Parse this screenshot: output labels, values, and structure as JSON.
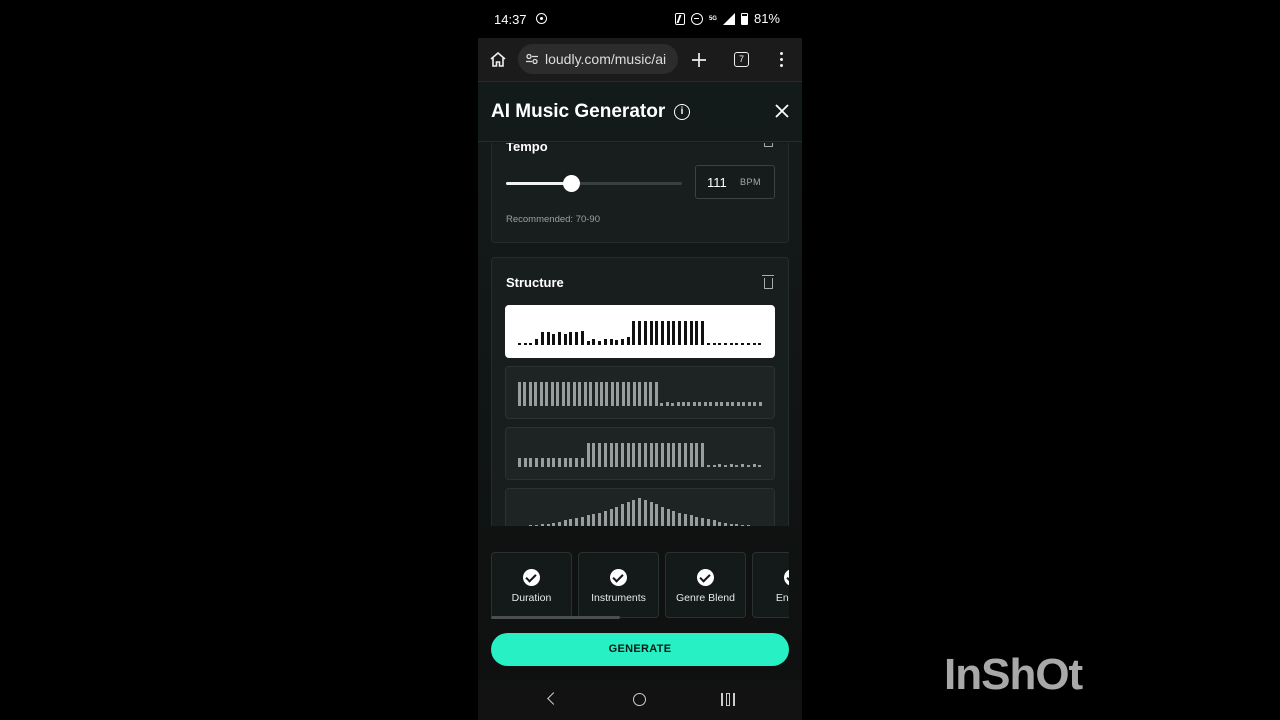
{
  "status_bar": {
    "time": "14:37",
    "network": "5G",
    "battery": "81%"
  },
  "browser": {
    "url": "loudly.com/music/ai",
    "tab_count": "7"
  },
  "panel": {
    "title": "AI Music Generator"
  },
  "tempo": {
    "title": "Tempo",
    "bpm_value": "111",
    "bpm_unit": "BPM",
    "slider_level": 0.37,
    "recommended": "Recommended: 70-90"
  },
  "structure": {
    "title": "Structure",
    "selected_index": 0,
    "patterns": [
      [
        2,
        2,
        2,
        6,
        12,
        12,
        10,
        12,
        10,
        12,
        12,
        13,
        4,
        6,
        4,
        6,
        6,
        5,
        6,
        7,
        22,
        22,
        22,
        22,
        22,
        22,
        22,
        22,
        22,
        22,
        22,
        22,
        22,
        2,
        2,
        2,
        2,
        2,
        2,
        2,
        2,
        2,
        2
      ],
      [
        22,
        22,
        22,
        22,
        22,
        22,
        22,
        22,
        22,
        22,
        22,
        22,
        22,
        22,
        22,
        22,
        22,
        22,
        22,
        22,
        22,
        22,
        22,
        22,
        22,
        22,
        3,
        4,
        3,
        4,
        4,
        4,
        4,
        4,
        4,
        4,
        4,
        4,
        4,
        4,
        4,
        4,
        4,
        4,
        4
      ],
      [
        8,
        8,
        8,
        8,
        8,
        8,
        8,
        8,
        8,
        8,
        8,
        8,
        22,
        22,
        22,
        22,
        22,
        22,
        22,
        22,
        22,
        22,
        22,
        22,
        22,
        22,
        22,
        22,
        22,
        22,
        22,
        22,
        22,
        2,
        2,
        3,
        2,
        3,
        2,
        3,
        2,
        3,
        2
      ],
      [
        2,
        2,
        3,
        3,
        4,
        4,
        5,
        6,
        7,
        8,
        9,
        10,
        12,
        13,
        14,
        16,
        18,
        20,
        22,
        24,
        26,
        28,
        26,
        24,
        22,
        20,
        18,
        16,
        14,
        13,
        12,
        10,
        9,
        8,
        7,
        6,
        5,
        4,
        4,
        3,
        3,
        2,
        2
      ]
    ]
  },
  "options": [
    {
      "label": "Duration",
      "checked": true
    },
    {
      "label": "Instruments",
      "checked": true
    },
    {
      "label": "Genre Blend",
      "checked": true
    },
    {
      "label": "Energy",
      "checked": true
    }
  ],
  "generate_label": "GENERATE",
  "watermark": "InShOt",
  "colors": {
    "accent": "#26f0c4",
    "panel_bg": "#131a1a"
  }
}
